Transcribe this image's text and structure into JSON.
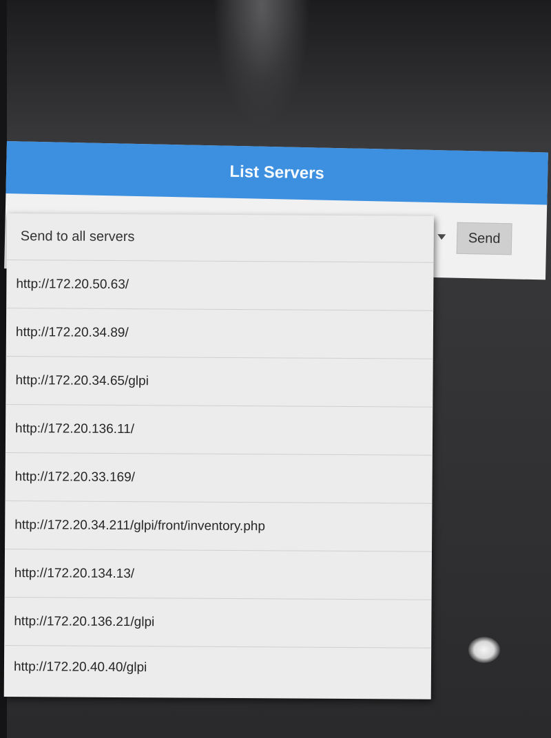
{
  "dialog": {
    "title": "List Servers",
    "send_label": "Send"
  },
  "dropdown": {
    "options": [
      "Send to all servers",
      "http://172.20.50.63/",
      "http://172.20.34.89/",
      "http://172.20.34.65/glpi",
      "http://172.20.136.11/",
      "http://172.20.33.169/",
      "http://172.20.34.211/glpi/front/inventory.php",
      "http://172.20.134.13/",
      "http://172.20.136.21/glpi",
      "http://172.20.40.40/glpi"
    ]
  }
}
